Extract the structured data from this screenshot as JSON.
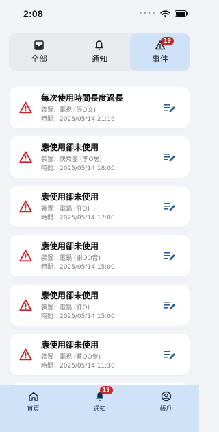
{
  "status_bar": {
    "time": "2:08",
    "dots": "••••"
  },
  "tabs": [
    {
      "label": "全部",
      "icon": "inbox-icon"
    },
    {
      "label": "通知",
      "icon": "bell-icon"
    },
    {
      "label": "事件",
      "icon": "warning-icon",
      "badge": "19",
      "active": true
    }
  ],
  "events": [
    {
      "title": "每次使用時間長度過長",
      "device": "裝置：電視 (張O文)",
      "time": "時間：2025/05/14 21:16"
    },
    {
      "title": "應使用卻未使用",
      "device": "裝置：快煮壺 (李O居)",
      "time": "時間：2025/05/14 18:00"
    },
    {
      "title": "應使用卻未使用",
      "device": "裝置：電鍋 (許O)",
      "time": "時間：2025/05/14 17:00"
    },
    {
      "title": "應使用卻未使用",
      "device": "裝置：電鍋 (謝OO音)",
      "time": "時間：2025/05/14 15:00"
    },
    {
      "title": "應使用卻未使用",
      "device": "裝置：電鍋 (許O)",
      "time": "時間：2025/05/14 15:00"
    },
    {
      "title": "應使用卻未使用",
      "device": "裝置：電視 (蔡OO參)",
      "time": "時間：2025/05/14 11:30"
    }
  ],
  "bottom_nav": [
    {
      "label": "首頁",
      "icon": "home-icon"
    },
    {
      "label": "通知",
      "icon": "bell-filled-icon",
      "badge": "19"
    },
    {
      "label": "帳戶",
      "icon": "account-icon"
    }
  ],
  "colors": {
    "accent": "#cfe2f7",
    "warning": "#c8222b",
    "edit": "#2b5d96",
    "badge": "#d0242c"
  }
}
